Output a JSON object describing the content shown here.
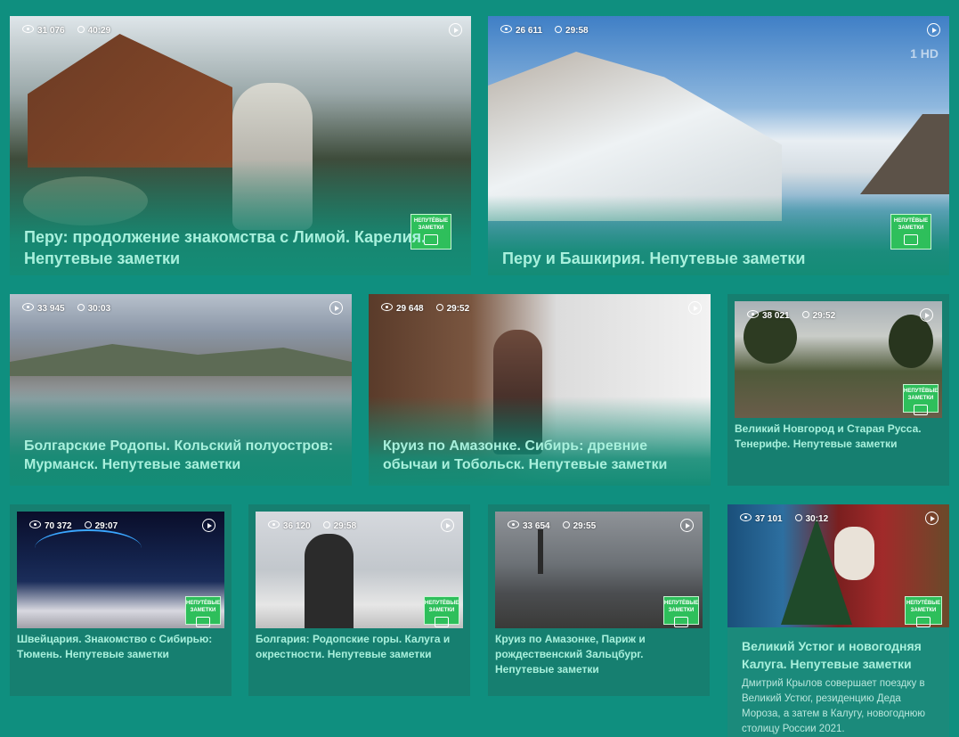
{
  "cards": [
    {
      "views": "31 076",
      "duration": "40:29",
      "title": "Перу: продолжение знакомства с Лимой. Карелия. Непутевые заметки"
    },
    {
      "views": "26 611",
      "duration": "29:58",
      "title": "Перу и Башкирия. Непутевые заметки"
    },
    {
      "views": "33 945",
      "duration": "30:03",
      "title": "Болгарские Родопы. Кольский полуостров: Мурманск. Непутевые заметки"
    },
    {
      "views": "29 648",
      "duration": "29:52",
      "title": "Круиз по Амазонке. Сибирь: древние обычаи и Тобольск. Непутевые заметки"
    },
    {
      "views": "38 021",
      "duration": "29:52",
      "title": "Великий Новгород и Старая Русса. Тенерифе. Непутевые заметки"
    },
    {
      "views": "70 372",
      "duration": "29:07",
      "title": "Швейцария. Знакомство с Сибирью: Тюмень. Непутевые заметки"
    },
    {
      "views": "36 120",
      "duration": "29:58",
      "title": "Болгария: Родопские горы. Калуга и окрестности. Непутевые заметки"
    },
    {
      "views": "33 654",
      "duration": "29:55",
      "title": "Круиз по Амазонке, Париж и рождественский Зальцбург. Непутевые заметки"
    },
    {
      "views": "37 101",
      "duration": "30:12",
      "title": "Великий Устюг и новогодняя Калуга. Непутевые заметки",
      "description": "Дмитрий Крылов совершает поездку в Великий Устюг, резиденцию Деда Мороза, а затем в Калугу, новогоднюю столицу России 2021."
    }
  ],
  "badge_text": "НЕПУТЁВЫЕ ЗАМЕТКИ",
  "channel_logo": "1 HD",
  "icons": {
    "views": "eye-icon",
    "duration": "clock-icon",
    "play": "play-icon"
  },
  "colors": {
    "background": "#0f8f7f",
    "title": "#a8f0dc",
    "badge": "#2ebf5b"
  }
}
